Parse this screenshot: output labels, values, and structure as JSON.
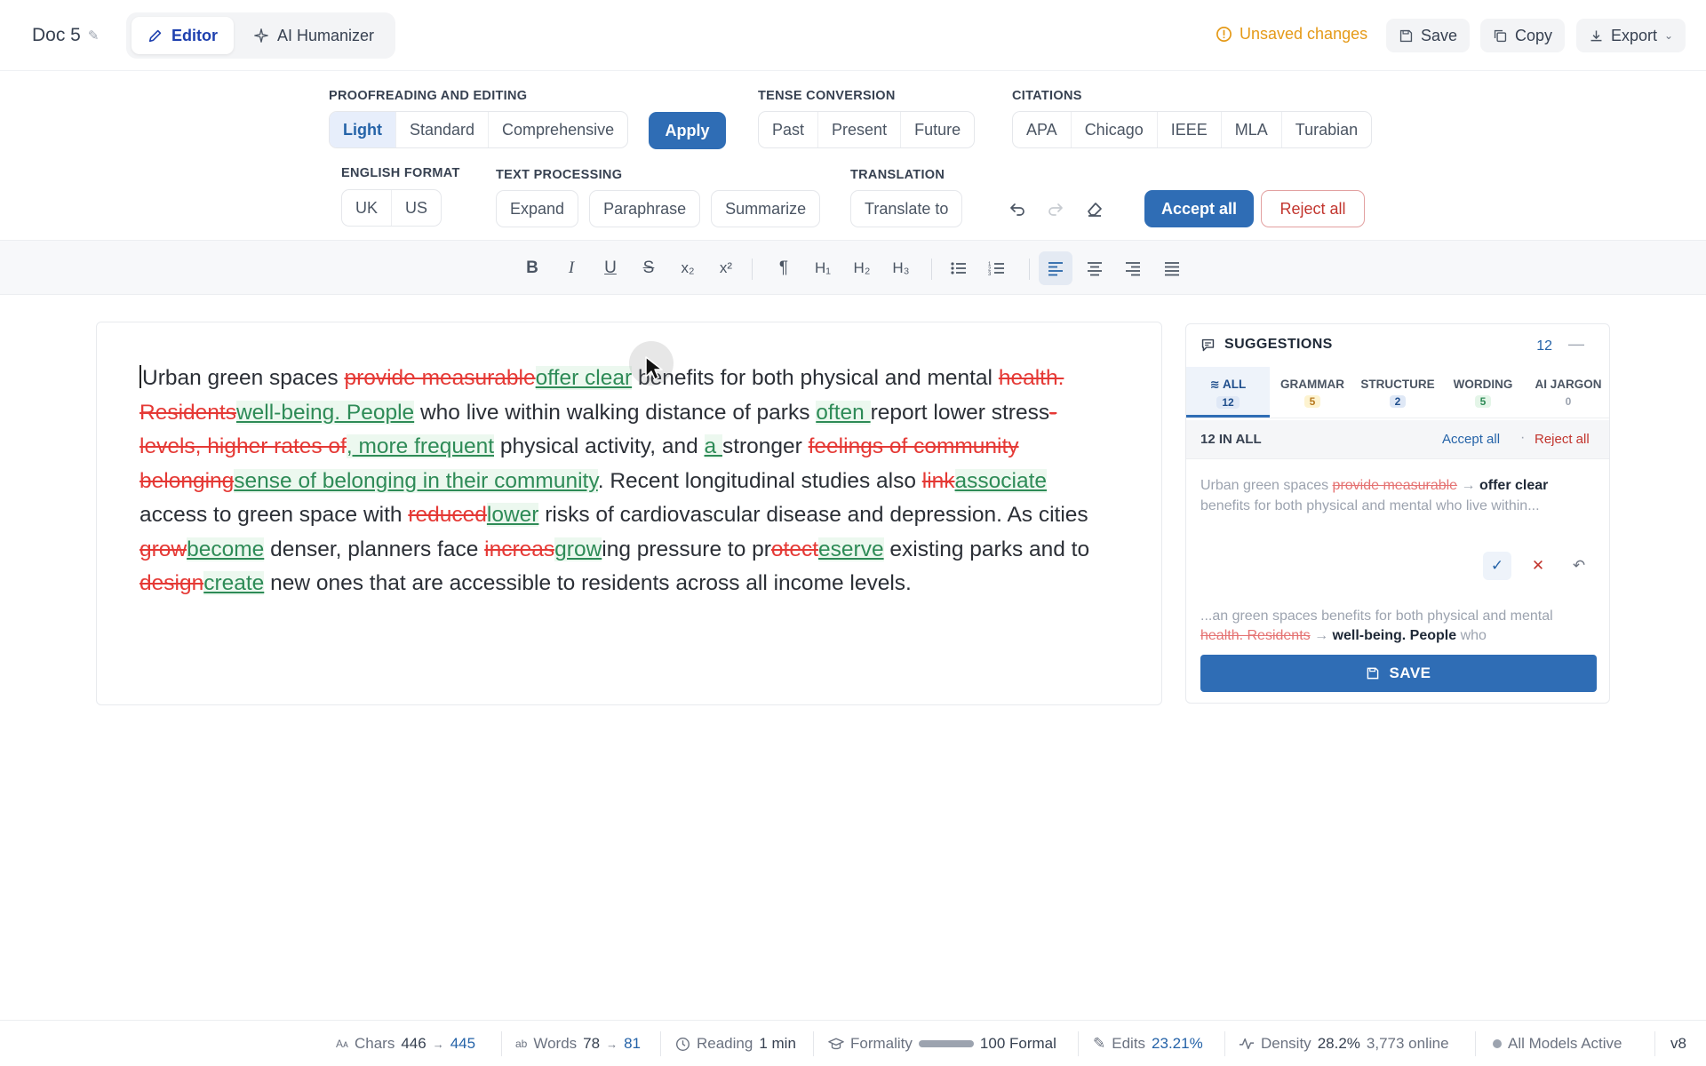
{
  "header": {
    "doc_title": "Doc 5",
    "tabs": [
      {
        "label": "Editor",
        "icon": "pencil-icon"
      },
      {
        "label": "AI Humanizer",
        "icon": "sparkle-icon"
      }
    ],
    "unsaved": "Unsaved changes",
    "save": "Save",
    "copy": "Copy",
    "export": "Export"
  },
  "toolbar": {
    "proofreading": {
      "label": "PROOFREADING AND EDITING",
      "options": [
        "Light",
        "Standard",
        "Comprehensive"
      ],
      "selected": "Light",
      "apply": "Apply"
    },
    "tense": {
      "label": "TENSE CONVERSION",
      "options": [
        "Past",
        "Present",
        "Future"
      ]
    },
    "citations": {
      "label": "CITATIONS",
      "options": [
        "APA",
        "Chicago",
        "IEEE",
        "MLA",
        "Turabian"
      ]
    },
    "english": {
      "label": "ENGLISH FORMAT",
      "options": [
        "UK",
        "US"
      ]
    },
    "text_processing": {
      "label": "TEXT PROCESSING",
      "options": [
        "Expand",
        "Paraphrase",
        "Summarize"
      ]
    },
    "translation": {
      "label": "TRANSLATION",
      "button": "Translate to"
    },
    "accept_all": "Accept all",
    "reject_all": "Reject all"
  },
  "format": {
    "bold": "B",
    "italic": "I",
    "underline": "U",
    "strike": "S",
    "subscript": "x₂",
    "superscript": "x²",
    "paragraph": "¶",
    "h1": "H₁",
    "h2": "H₂",
    "h3": "H₃"
  },
  "editor": {
    "segments": [
      {
        "t": "n",
        "v": "Urban green spaces "
      },
      {
        "t": "d",
        "v": "provide measurable"
      },
      {
        "t": "i",
        "v": "offer clear"
      },
      {
        "t": "n",
        "v": " benefits for both physical and mental "
      },
      {
        "t": "d",
        "v": "health. Residents"
      },
      {
        "t": "i",
        "v": "well-being. People"
      },
      {
        "t": "n",
        "v": " who live within walking distance of parks "
      },
      {
        "t": "i",
        "v": "often "
      },
      {
        "t": "n",
        "v": "report lower stress"
      },
      {
        "t": "d",
        "v": "-levels, higher rates of"
      },
      {
        "t": "i",
        "v": ", more frequent"
      },
      {
        "t": "n",
        "v": " physical activity, and "
      },
      {
        "t": "i",
        "v": "a "
      },
      {
        "t": "n",
        "v": "stronger "
      },
      {
        "t": "d",
        "v": "feelings of community belonging"
      },
      {
        "t": "i",
        "v": "sense of belonging in their community"
      },
      {
        "t": "n",
        "v": ". Recent longitudinal studies also "
      },
      {
        "t": "d",
        "v": "link"
      },
      {
        "t": "i",
        "v": "associate"
      },
      {
        "t": "n",
        "v": " access to green space with "
      },
      {
        "t": "d",
        "v": "reduced"
      },
      {
        "t": "i",
        "v": "lower"
      },
      {
        "t": "n",
        "v": " risks of cardiovascular disease and depression. As cities "
      },
      {
        "t": "d",
        "v": "grow"
      },
      {
        "t": "i",
        "v": "become"
      },
      {
        "t": "n",
        "v": " denser, planners face "
      },
      {
        "t": "d",
        "v": "increas"
      },
      {
        "t": "i",
        "v": "grow"
      },
      {
        "t": "n",
        "v": "ing pressure to pr"
      },
      {
        "t": "d",
        "v": "otect"
      },
      {
        "t": "i",
        "v": "eserve"
      },
      {
        "t": "n",
        "v": " existing parks and to "
      },
      {
        "t": "d",
        "v": "design"
      },
      {
        "t": "i",
        "v": "create"
      },
      {
        "t": "n",
        "v": " new ones that are accessible to residents across all income levels."
      }
    ]
  },
  "suggestions": {
    "title": "SUGGESTIONS",
    "count": "12",
    "tabs": [
      {
        "label": "ALL",
        "count": "12",
        "color": "blue"
      },
      {
        "label": "GRAMMAR",
        "count": "5",
        "color": "yellow"
      },
      {
        "label": "STRUCTURE",
        "count": "2",
        "color": "blue"
      },
      {
        "label": "WORDING",
        "count": "5",
        "color": "green"
      },
      {
        "label": "AI JARGON",
        "count": "0",
        "color": "gray"
      }
    ],
    "summary": "12 IN ALL",
    "accept_all": "Accept all",
    "reject_all": "Reject all",
    "card1": {
      "before": "Urban green spaces",
      "deleted": "provide measurable",
      "added": "offer clear",
      "after": "benefits for both physical and mental who live within..."
    },
    "card2": {
      "before": "...an green spaces benefits for both physical and mental",
      "deleted": "health. Residents",
      "added": "well-being. People",
      "after": "who"
    },
    "save": "SAVE"
  },
  "status": {
    "chars_label": "Chars",
    "chars_from": "446",
    "chars_to": "445",
    "words_label": "Words",
    "words_from": "78",
    "words_to": "81",
    "reading_label": "Reading",
    "reading_value": "1 min",
    "formality_label": "Formality",
    "formality_value": "100 Formal",
    "edits_label": "Edits",
    "edits_value": "23.21%",
    "density_label": "Density",
    "density_value": "28.2%",
    "online": "3,773 online",
    "models": "All Models Active",
    "version": "v8"
  }
}
